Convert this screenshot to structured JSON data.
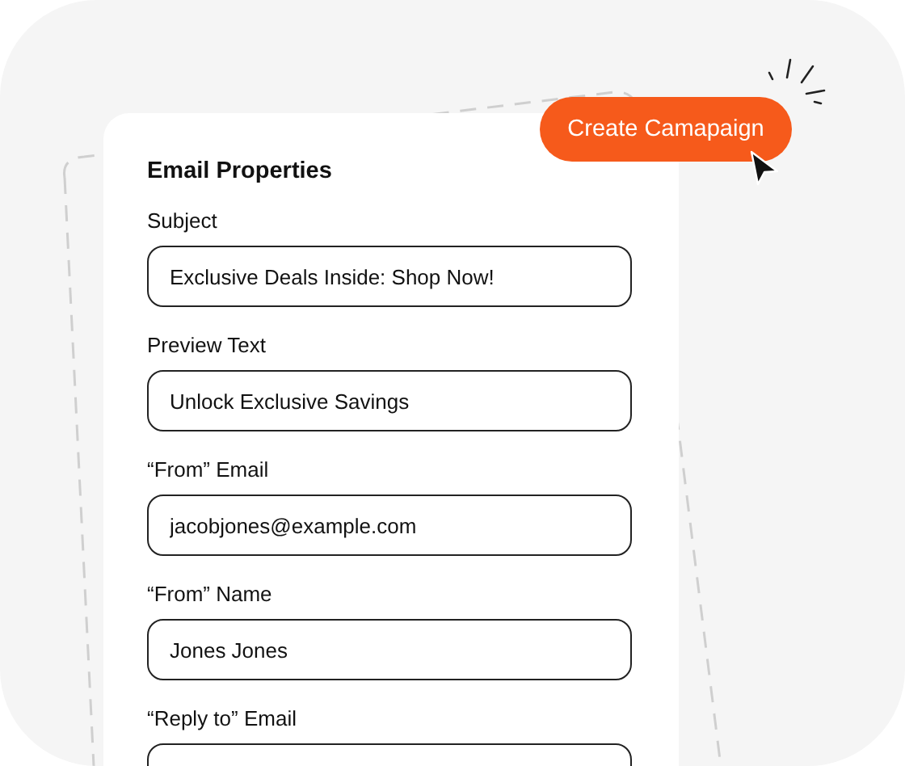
{
  "card": {
    "title": "Email Properties"
  },
  "fields": [
    {
      "label": "Subject",
      "value": "Exclusive Deals Inside: Shop Now!"
    },
    {
      "label": "Preview Text",
      "value": "Unlock Exclusive Savings"
    },
    {
      "label": "“From” Email",
      "value": "jacobjones@example.com"
    },
    {
      "label": "“From” Name",
      "value": "Jones Jones"
    },
    {
      "label": "“Reply to” Email"
    }
  ],
  "button": {
    "label": "Create Camapaign"
  }
}
